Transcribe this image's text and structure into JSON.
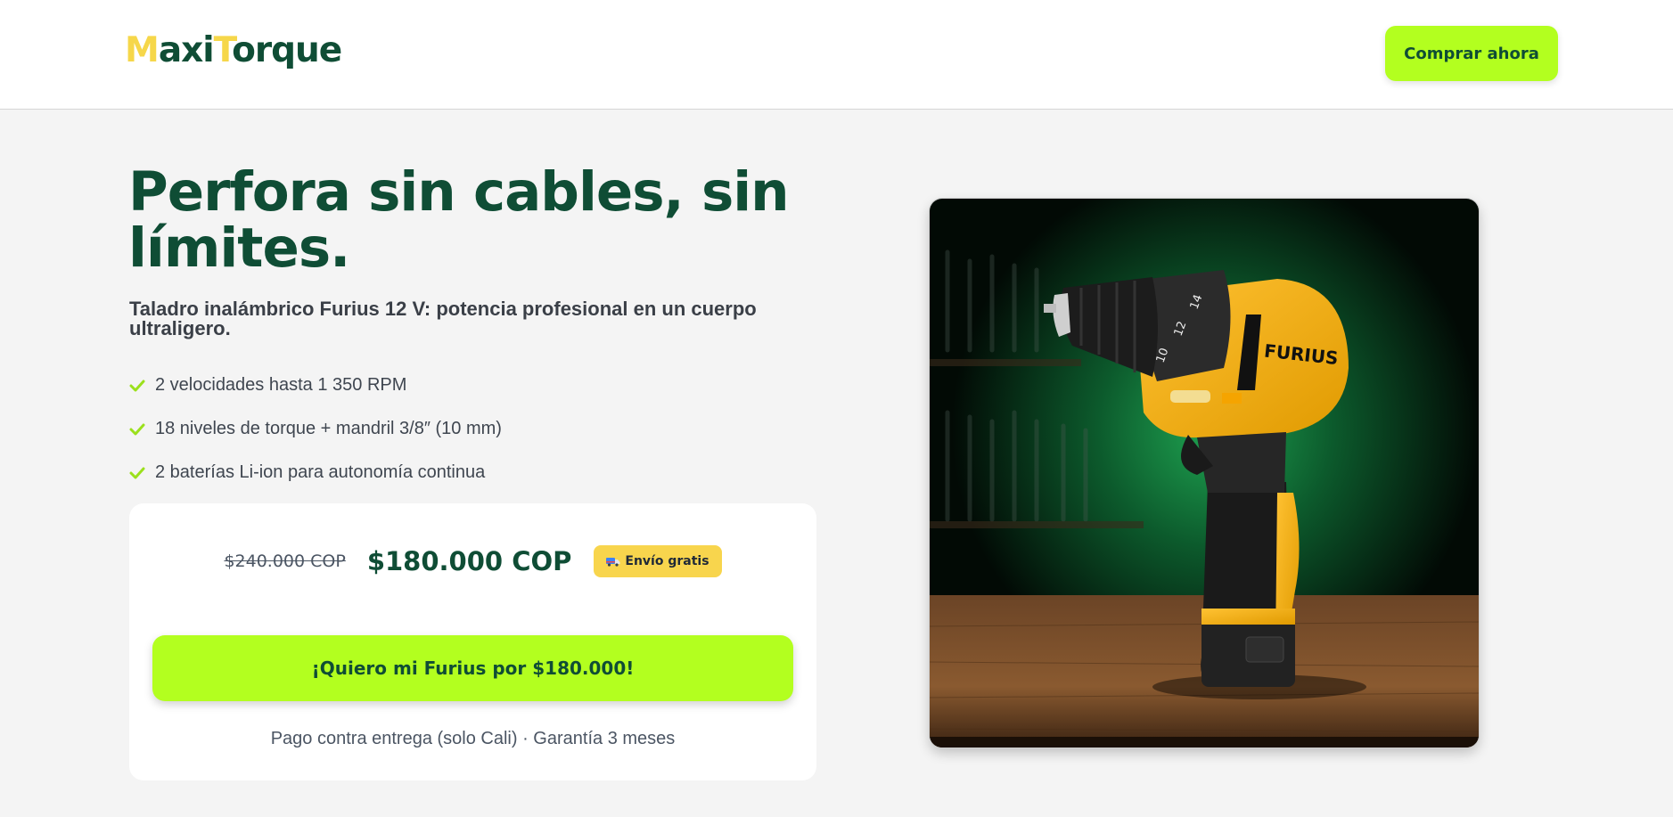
{
  "header": {
    "logo": {
      "initial_1": "M",
      "rest_1": "axi",
      "initial_2": "T",
      "rest_2": "orque"
    },
    "cta_label": "Comprar ahora"
  },
  "hero": {
    "title": "Perfora sin cables, sin límites.",
    "subtitle": "Taladro inalámbrico Furius 12 V: potencia profesional en un cuerpo ultraligero.",
    "features": [
      "2 velocidades hasta 1 350 RPM",
      "18 niveles de torque + mandril 3/8″ (10 mm)",
      "2 baterías Li-ion para autonomía continua"
    ]
  },
  "pricing": {
    "old_price": "$240.000 COP",
    "new_price": "$180.000 COP",
    "badge": "Envío gratis",
    "cta_label": "¡Quiero mi Furius por $180.000!",
    "note": "Pago contra entrega (solo Cali) · Garantía 3 meses"
  },
  "product_image": {
    "brand_on_tool": "FURIUS",
    "torque_marks": [
      "10",
      "12",
      "14"
    ]
  },
  "colors": {
    "brand_green": "#0f4d35",
    "accent_lime": "#b3ff1f",
    "accent_yellow": "#f8d54d",
    "background": "#f4f4f4"
  }
}
